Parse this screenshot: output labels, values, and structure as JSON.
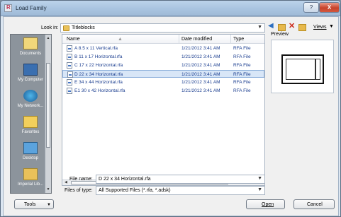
{
  "window": {
    "title": "Load Family",
    "help_label": "?",
    "close_label": "X"
  },
  "lookin": {
    "label": "Look in:",
    "value": "Titleblocks"
  },
  "toolbar": {
    "back_icon": "back-arrow-icon",
    "up_icon": "up-folder-icon",
    "delete_icon": "delete-icon",
    "newfolder_icon": "new-folder-icon",
    "views_label": "Views"
  },
  "places": [
    {
      "label": "Documents",
      "icon": "documents-icon"
    },
    {
      "label": "My Computer",
      "icon": "computer-icon"
    },
    {
      "label": "My Network...",
      "icon": "network-icon"
    },
    {
      "label": "Favorites",
      "icon": "favorites-icon"
    },
    {
      "label": "Desktop",
      "icon": "desktop-icon"
    },
    {
      "label": "Imperial Lib...",
      "icon": "library-folder-icon"
    }
  ],
  "filelist": {
    "columns": [
      "Name",
      "Date modified",
      "Type"
    ],
    "rows": [
      {
        "name": "A 8.5 x 11 Vertical.rfa",
        "date": "1/21/2012 3:41 AM",
        "type": "RFA File"
      },
      {
        "name": "B 11 x 17 Horizontal.rfa",
        "date": "1/21/2012 3:41 AM",
        "type": "RFA File"
      },
      {
        "name": "C 17 x 22 Horizontal.rfa",
        "date": "1/21/2012 3:41 AM",
        "type": "RFA File"
      },
      {
        "name": "D 22 x 34 Horizontal.rfa",
        "date": "1/21/2012 3:41 AM",
        "type": "RFA File",
        "selected": true
      },
      {
        "name": "E 34 x 44 Horizontal.rfa",
        "date": "1/21/2012 3:41 AM",
        "type": "RFA File"
      },
      {
        "name": "E1 30 x 42 Horizontal.rfa",
        "date": "1/21/2012 3:41 AM",
        "type": "RFA File"
      }
    ],
    "hscroll_grip": "III"
  },
  "preview": {
    "label": "Preview"
  },
  "fields": {
    "filename_label": "File name:",
    "filename_value": "D 22 x 34 Horizontal.rfa",
    "filetype_label": "Files of type:",
    "filetype_value": "All Supported Files  (*.rfa, *.adsk)"
  },
  "buttons": {
    "tools": "Tools",
    "open": "Open",
    "cancel": "Cancel"
  }
}
